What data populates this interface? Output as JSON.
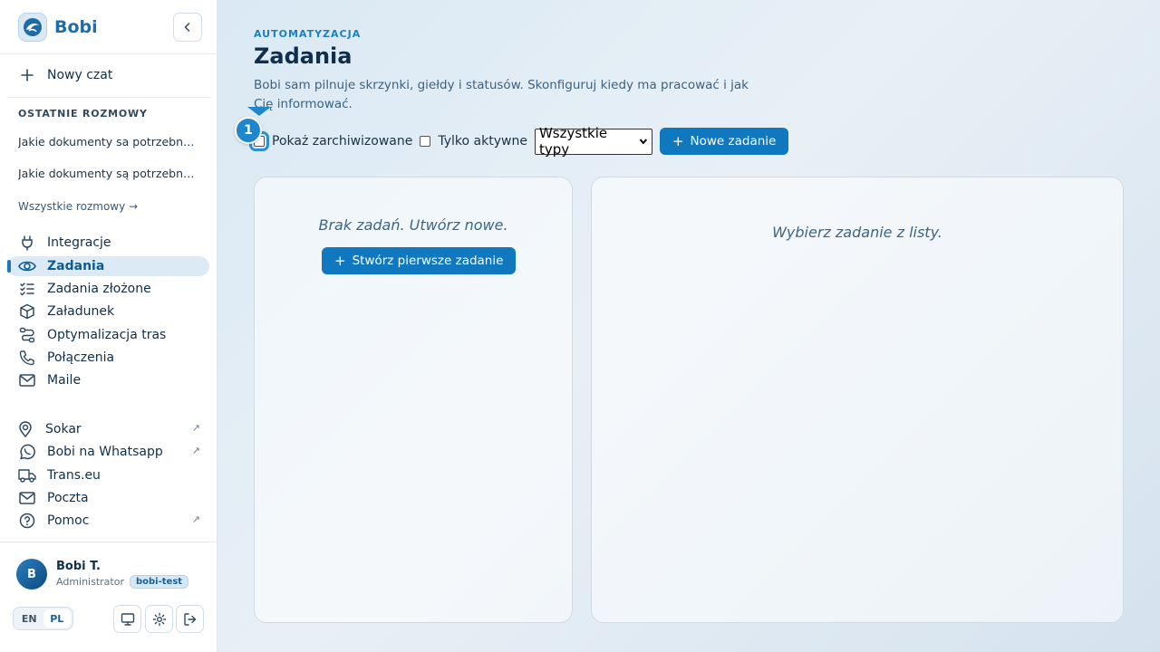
{
  "sidebar": {
    "brand": "Bobi",
    "new_chat": "Nowy czat",
    "recent_label": "OSTATNIE ROZMOWY",
    "recent": [
      "Jakie dokumenty sa potrzebne do...",
      "Jakie dokumenty są potrzebne do..."
    ],
    "all_conversations": "Wszystkie rozmowy →",
    "nav": [
      {
        "label": "Integracje",
        "icon": "plug-icon"
      },
      {
        "label": "Zadania",
        "icon": "eye-icon",
        "active": true
      },
      {
        "label": "Zadania złożone",
        "icon": "list-check-icon"
      },
      {
        "label": "Załadunek",
        "icon": "package-icon"
      },
      {
        "label": "Optymalizacja tras",
        "icon": "route-icon"
      },
      {
        "label": "Połączenia",
        "icon": "phone-icon"
      },
      {
        "label": "Maile",
        "icon": "mail-icon"
      }
    ],
    "external": [
      {
        "label": "Sokar",
        "icon": "map-pin-icon",
        "arrow": "↗"
      },
      {
        "label": "Bobi na Whatsapp",
        "icon": "whatsapp-icon",
        "arrow": "↗"
      },
      {
        "label": "Trans.eu",
        "icon": "truck-icon"
      },
      {
        "label": "Poczta",
        "icon": "mail-icon"
      },
      {
        "label": "Pomoc",
        "icon": "help-circle-icon",
        "arrow": "↗"
      }
    ],
    "user": {
      "initial": "B",
      "name": "Bobi T.",
      "role": "Administrator",
      "tag": "bobi-test"
    },
    "lang": {
      "en": "EN",
      "pl": "PL",
      "selected": "PL"
    }
  },
  "main": {
    "eyebrow": "AUTOMATYZACJA",
    "title": "Zadania",
    "description": "Bobi sam pilnuje skrzynki, giełdy i statusów. Skonfiguruj kiedy ma pracować i jak Cię informować.",
    "show_archived": "Pokaż zarchiwizowane",
    "only_active": "Tylko aktywne",
    "type_select": "Wszystkie typy",
    "new_task": "Nowe zadanie",
    "empty_list": "Brak zadań. Utwórz nowe.",
    "create_first": "Stwórz pierwsze zadanie",
    "select_hint": "Wybierz zadanie z listy.",
    "marker": "1"
  },
  "colors": {
    "accent": "#0f78bf",
    "brand": "#1d6ea8",
    "active_bg": "#dbeaf5"
  }
}
